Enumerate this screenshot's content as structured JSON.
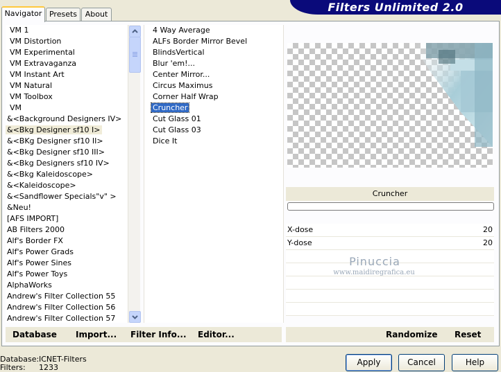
{
  "app": {
    "title": "Filters Unlimited 2.0"
  },
  "tabs": [
    {
      "label": "Navigator",
      "active": true
    },
    {
      "label": "Presets",
      "active": false
    },
    {
      "label": "About",
      "active": false
    }
  ],
  "categories": {
    "items": [
      "VM 1",
      "VM Distortion",
      "VM Experimental",
      "VM Extravaganza",
      "VM Instant Art",
      "VM Natural",
      "VM Toolbox",
      "VM",
      "&<Background Designers IV>",
      "&<Bkg Designer sf10 I>",
      "&<BKg Designer sf10 II>",
      "&<Bkg Designer sf10 III>",
      "&<Bkg Designers sf10 IV>",
      "&<Bkg Kaleidoscope>",
      "&<Kaleidoscope>",
      "&<Sandflower Specials\"v\" >",
      "&Neu!",
      "[AFS IMPORT]",
      "AB Filters 2000",
      "Alf's Border FX",
      "Alf's Power Grads",
      "Alf's Power Sines",
      "Alf's Power Toys",
      "AlphaWorks",
      "Andrew's Filter Collection 55",
      "Andrew's Filter Collection 56",
      "Andrew's Filter Collection 57"
    ],
    "highlighted_index": 9
  },
  "filters": {
    "items": [
      "4 Way Average",
      "ALFs Border Mirror Bevel",
      "BlindsVertical",
      "Blur 'em!...",
      "Center Mirror...",
      "Circus Maximus",
      "Corner Half Wrap",
      "Cruncher",
      "Cut Glass 01",
      "Cut Glass 03",
      "Dice It"
    ],
    "selected_index": 7
  },
  "preview": {
    "filter_name": "Cruncher",
    "progress": 0,
    "params": [
      {
        "label": "X-dose",
        "value": "20"
      },
      {
        "label": "Y-dose",
        "value": "20"
      }
    ],
    "watermark": {
      "name": "Pinuccia",
      "site": "www.maidiregrafica.eu"
    }
  },
  "left_buttons": {
    "database": "Database",
    "import": "Import...",
    "filter_info": "Filter Info...",
    "editor": "Editor..."
  },
  "right_buttons": {
    "randomize": "Randomize",
    "reset": "Reset"
  },
  "dialog_buttons": {
    "apply": "Apply",
    "cancel": "Cancel",
    "help": "Help"
  },
  "status": {
    "database_label": "Database:",
    "database_value": "ICNET-Filters",
    "filters_label": "Filters:",
    "filters_value": "1233"
  },
  "colors": {
    "selection": "#316ac5",
    "banner": "#0a0a7a",
    "dialog_bg": "#ece9d8"
  }
}
